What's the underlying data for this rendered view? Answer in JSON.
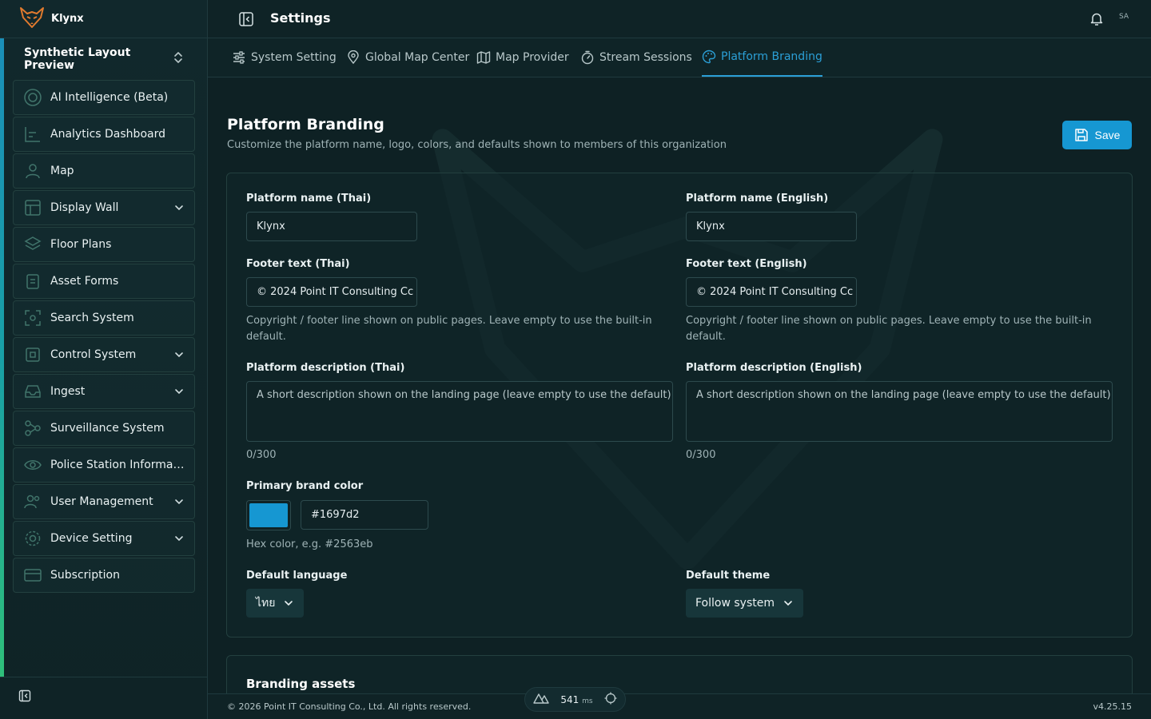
{
  "app": {
    "name": "Klynx"
  },
  "organization": {
    "name": "Synthetic Layout Preview"
  },
  "sidebar": {
    "items": [
      {
        "label": "AI Intelligence (Beta)",
        "icon": "target-icon",
        "has_children": false
      },
      {
        "label": "Analytics Dashboard",
        "icon": "chart-icon",
        "has_children": false
      },
      {
        "label": "Map",
        "icon": "person-icon",
        "has_children": false
      },
      {
        "label": "Display Wall",
        "icon": "layout-icon",
        "has_children": true
      },
      {
        "label": "Floor Plans",
        "icon": "layers-icon",
        "has_children": false
      },
      {
        "label": "Asset Forms",
        "icon": "clipboard-icon",
        "has_children": false
      },
      {
        "label": "Search System",
        "icon": "scan-icon",
        "has_children": false
      },
      {
        "label": "Control System",
        "icon": "cpu-icon",
        "has_children": true
      },
      {
        "label": "Ingest",
        "icon": "inbox-icon",
        "has_children": true
      },
      {
        "label": "Surveillance System",
        "icon": "network-icon",
        "has_children": false
      },
      {
        "label": "Police Station Informati...",
        "icon": "eye-icon",
        "has_children": false
      },
      {
        "label": "User Management",
        "icon": "users-icon",
        "has_children": true
      },
      {
        "label": "Device Setting",
        "icon": "gear-icon",
        "has_children": true
      },
      {
        "label": "Subscription",
        "icon": "card-icon",
        "has_children": false
      }
    ]
  },
  "header": {
    "title": "Settings",
    "avatar": "SA"
  },
  "tabs": [
    {
      "label": "System Setting",
      "icon": "sliders-icon"
    },
    {
      "label": "Global Map Center",
      "icon": "map-pin-icon"
    },
    {
      "label": "Map Provider",
      "icon": "map-icon"
    },
    {
      "label": "Stream Sessions",
      "icon": "timer-icon"
    },
    {
      "label": "Platform Branding",
      "icon": "palette-icon",
      "active": true
    }
  ],
  "page": {
    "title": "Platform Branding",
    "subtitle": "Customize the platform name, logo, colors, and defaults shown to members of this organization",
    "save_label": "Save"
  },
  "form": {
    "name_th": {
      "label": "Platform name (Thai)",
      "value": "Klynx"
    },
    "name_en": {
      "label": "Platform name (English)",
      "value": "Klynx"
    },
    "footer_th": {
      "label": "Footer text (Thai)",
      "value": "© 2024 Point IT Consulting Cc",
      "help_line1": "Copyright / footer line shown on public pages. Leave empty to use the built-in",
      "help_line2": "default."
    },
    "footer_en": {
      "label": "Footer text (English)",
      "value": "© 2024 Point IT Consulting Cc",
      "help_line1": "Copyright / footer line shown on public pages. Leave empty to use the built-in",
      "help_line2": "default."
    },
    "desc_th": {
      "label": "Platform description (Thai)",
      "placeholder": "A short description shown on the landing page (leave empty to use the default)",
      "counter": "0/300"
    },
    "desc_en": {
      "label": "Platform description (English)",
      "placeholder": "A short description shown on the landing page (leave empty to use the default)",
      "counter": "0/300"
    },
    "brand_color": {
      "label": "Primary brand color",
      "value": "#1697d2",
      "help": "Hex color, e.g. #2563eb"
    },
    "default_language": {
      "label": "Default language",
      "value": "ไทย"
    },
    "default_theme": {
      "label": "Default theme",
      "value": "Follow system"
    }
  },
  "assets_section": {
    "title": "Branding assets"
  },
  "footer": {
    "copyright": "© 2026 Point IT Consulting Co., Ltd. All rights reserved.",
    "version": "v4.25.15",
    "latency_value": "541",
    "latency_unit": "ms"
  },
  "colors": {
    "accent": "#1697d2",
    "background": "#0d1f22",
    "logo_orange": "#e07a2e"
  }
}
